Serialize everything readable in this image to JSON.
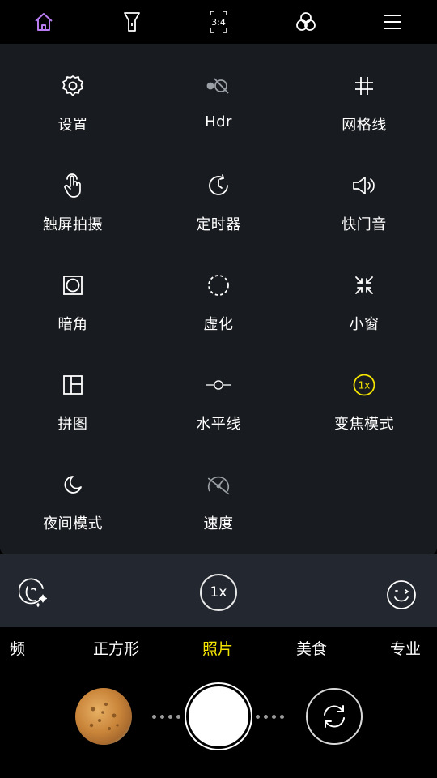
{
  "top_bar": {
    "icons": [
      "home-icon",
      "flashlight-icon",
      "aspect-ratio-icon",
      "filters-icon",
      "menu-icon"
    ],
    "aspect_ratio": "3:4",
    "active_color": "#b87cf0"
  },
  "settings": [
    {
      "label": "设置",
      "icon": "gear-icon"
    },
    {
      "label": "Hdr",
      "icon": "hdr-off-icon"
    },
    {
      "label": "网格线",
      "icon": "grid-icon"
    },
    {
      "label": "触屏拍摄",
      "icon": "touch-icon"
    },
    {
      "label": "定时器",
      "icon": "timer-icon"
    },
    {
      "label": "快门音",
      "icon": "speaker-icon"
    },
    {
      "label": "暗角",
      "icon": "vignette-icon"
    },
    {
      "label": "虚化",
      "icon": "blur-icon"
    },
    {
      "label": "小窗",
      "icon": "shrink-icon"
    },
    {
      "label": "拼图",
      "icon": "collage-icon"
    },
    {
      "label": "水平线",
      "icon": "level-icon"
    },
    {
      "label": "变焦模式",
      "icon": "zoom-mode-icon",
      "badge": "1x",
      "color": "#f5e400"
    },
    {
      "label": "夜间模式",
      "icon": "moon-icon"
    },
    {
      "label": "速度",
      "icon": "speed-icon"
    }
  ],
  "strip": {
    "zoom_label": "1x",
    "left_icon": "beauty-icon",
    "right_icon": "smile-icon"
  },
  "modes": {
    "items": [
      "频",
      "正方形",
      "照片",
      "美食",
      "专业"
    ],
    "active": "照片",
    "active_color": "#f5e400"
  },
  "controls": {
    "thumbnail_icon": "gallery-thumbnail",
    "shutter_icon": "shutter-button",
    "switch_icon": "switch-camera-icon"
  }
}
